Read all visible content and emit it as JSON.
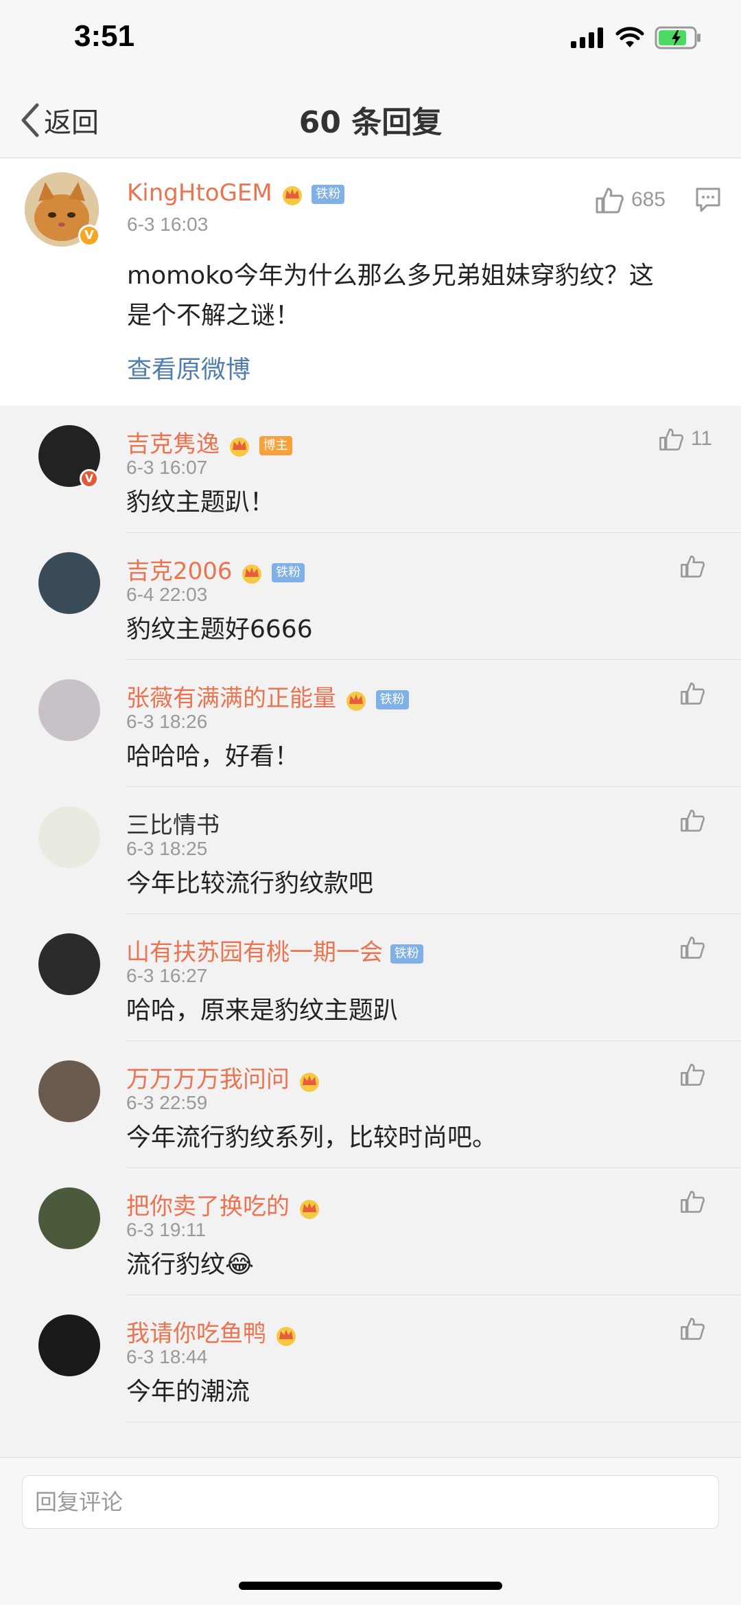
{
  "status": {
    "time": "3:51"
  },
  "nav": {
    "back_label": "返回",
    "title": "60 条回复"
  },
  "main_post": {
    "username": "KingHtoGEM",
    "tag": "铁粉",
    "time": "6-3 16:03",
    "likes": "685",
    "content_line1": "momoko今年为什么那么多兄弟姐妹穿豹纹？这",
    "content_line2": "是个不解之谜！",
    "view_original": "查看原微博"
  },
  "replies": [
    {
      "username": "吉克隽逸",
      "crown": true,
      "tag": "博主",
      "tag_type": "host",
      "time": "6-3 16:07",
      "content": "豹纹主题趴！",
      "likes": "11",
      "avatar_color": "#222222",
      "verified": true
    },
    {
      "username": "吉克2006",
      "crown": true,
      "tag": "铁粉",
      "tag_type": "fan",
      "time": "6-4 22:03",
      "content": "豹纹主题好6666",
      "likes": "",
      "avatar_color": "#3a4b58",
      "verified": false
    },
    {
      "username": "张薇有满满的正能量",
      "crown": true,
      "tag": "铁粉",
      "tag_type": "fan",
      "time": "6-3 18:26",
      "content": "哈哈哈，好看！",
      "likes": "",
      "avatar_color": "#c9c1c8",
      "verified": false
    },
    {
      "username": "三比情书",
      "crown": false,
      "tag": "",
      "tag_type": "",
      "time": "6-3 18:25",
      "content": "今年比较流行豹纹款吧",
      "likes": "",
      "avatar_color": "#e8ebe0",
      "verified": false
    },
    {
      "username": "山有扶苏园有桃一期一会",
      "crown": false,
      "tag": "铁粉",
      "tag_type": "fan",
      "time": "6-3 16:27",
      "content": "哈哈，原来是豹纹主题趴",
      "likes": "",
      "avatar_color": "#2b2b2b",
      "verified": false
    },
    {
      "username": "万万万万我问问",
      "crown": true,
      "tag": "",
      "tag_type": "",
      "time": "6-3 22:59",
      "content": "今年流行豹纹系列，比较时尚吧。",
      "likes": "",
      "avatar_color": "#6b5a4e",
      "verified": false
    },
    {
      "username": "把你卖了换吃的",
      "crown": true,
      "tag": "",
      "tag_type": "",
      "time": "6-3 19:11",
      "content": "流行豹纹😂",
      "likes": "",
      "avatar_color": "#4a5a3a",
      "verified": false
    },
    {
      "username": "我请你吃鱼鸭",
      "crown": true,
      "tag": "",
      "tag_type": "",
      "time": "6-3 18:44",
      "content": "今年的潮流",
      "likes": "",
      "avatar_color": "#1a1a1a",
      "verified": false
    }
  ],
  "bottom": {
    "placeholder": "回复评论"
  },
  "colors": {
    "username_orange": "#eb7350",
    "link_blue": "#507daf",
    "fan_tag": "#7fb0e8",
    "host_tag": "#f7a13c"
  }
}
